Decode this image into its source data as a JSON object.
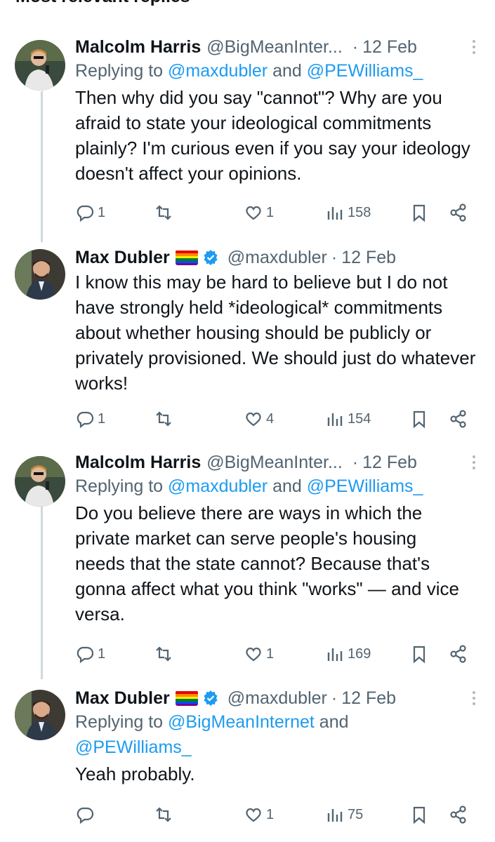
{
  "header": {
    "title": "Most relevant replies"
  },
  "tweets": [
    {
      "author": "Malcolm Harris",
      "handle": "@BigMeanInter...",
      "time": "12 Feb",
      "reply_prefix": "Replying to ",
      "reply_handle_1": "@maxdubler",
      "reply_and": " and ",
      "reply_handle_2": "@PEWilliams_",
      "text": "Then why did you say \"cannot\"? Why are you afraid to state your ideological commitments plainly? I'm curious even if you say your ideology doesn't affect your opinions.",
      "replies": "1",
      "reposts": "",
      "likes": "1",
      "views": "158"
    },
    {
      "author": "Max Dubler",
      "handle": "@maxdubler",
      "time": "12 Feb",
      "text": "I know this may be hard to believe but I do not have strongly held *ideological* commitments about whether housing should be publicly or privately provisioned. We should just do whatever works!",
      "replies": "1",
      "reposts": "",
      "likes": "4",
      "views": "154"
    },
    {
      "author": "Malcolm Harris",
      "handle": "@BigMeanInter...",
      "time": "12 Feb",
      "reply_prefix": "Replying to ",
      "reply_handle_1": "@maxdubler",
      "reply_and": " and ",
      "reply_handle_2": "@PEWilliams_",
      "text": "Do you believe there are ways in which the private market can serve people's housing needs that the state cannot? Because that's gonna affect what you think \"works\" — and vice versa.",
      "replies": "1",
      "reposts": "",
      "likes": "1",
      "views": "169"
    },
    {
      "author": "Max Dubler",
      "handle": "@maxdubler",
      "time": "12 Feb",
      "reply_prefix": "Replying to ",
      "reply_handle_1": "@BigMeanInternet",
      "reply_and": " and ",
      "reply_handle_2": "@PEWilliams_",
      "text": "Yeah probably.",
      "replies": "",
      "reposts": "",
      "likes": "1",
      "views": "75"
    }
  ],
  "colors": {
    "link": "#1d9bf0",
    "muted": "#536471",
    "verified": "#1d9bf0"
  },
  "icons": [
    "reply-icon",
    "repost-icon",
    "like-icon",
    "views-icon",
    "bookmark-icon",
    "share-icon",
    "more-icon",
    "verified-badge-icon",
    "rainbow-flag-icon"
  ]
}
